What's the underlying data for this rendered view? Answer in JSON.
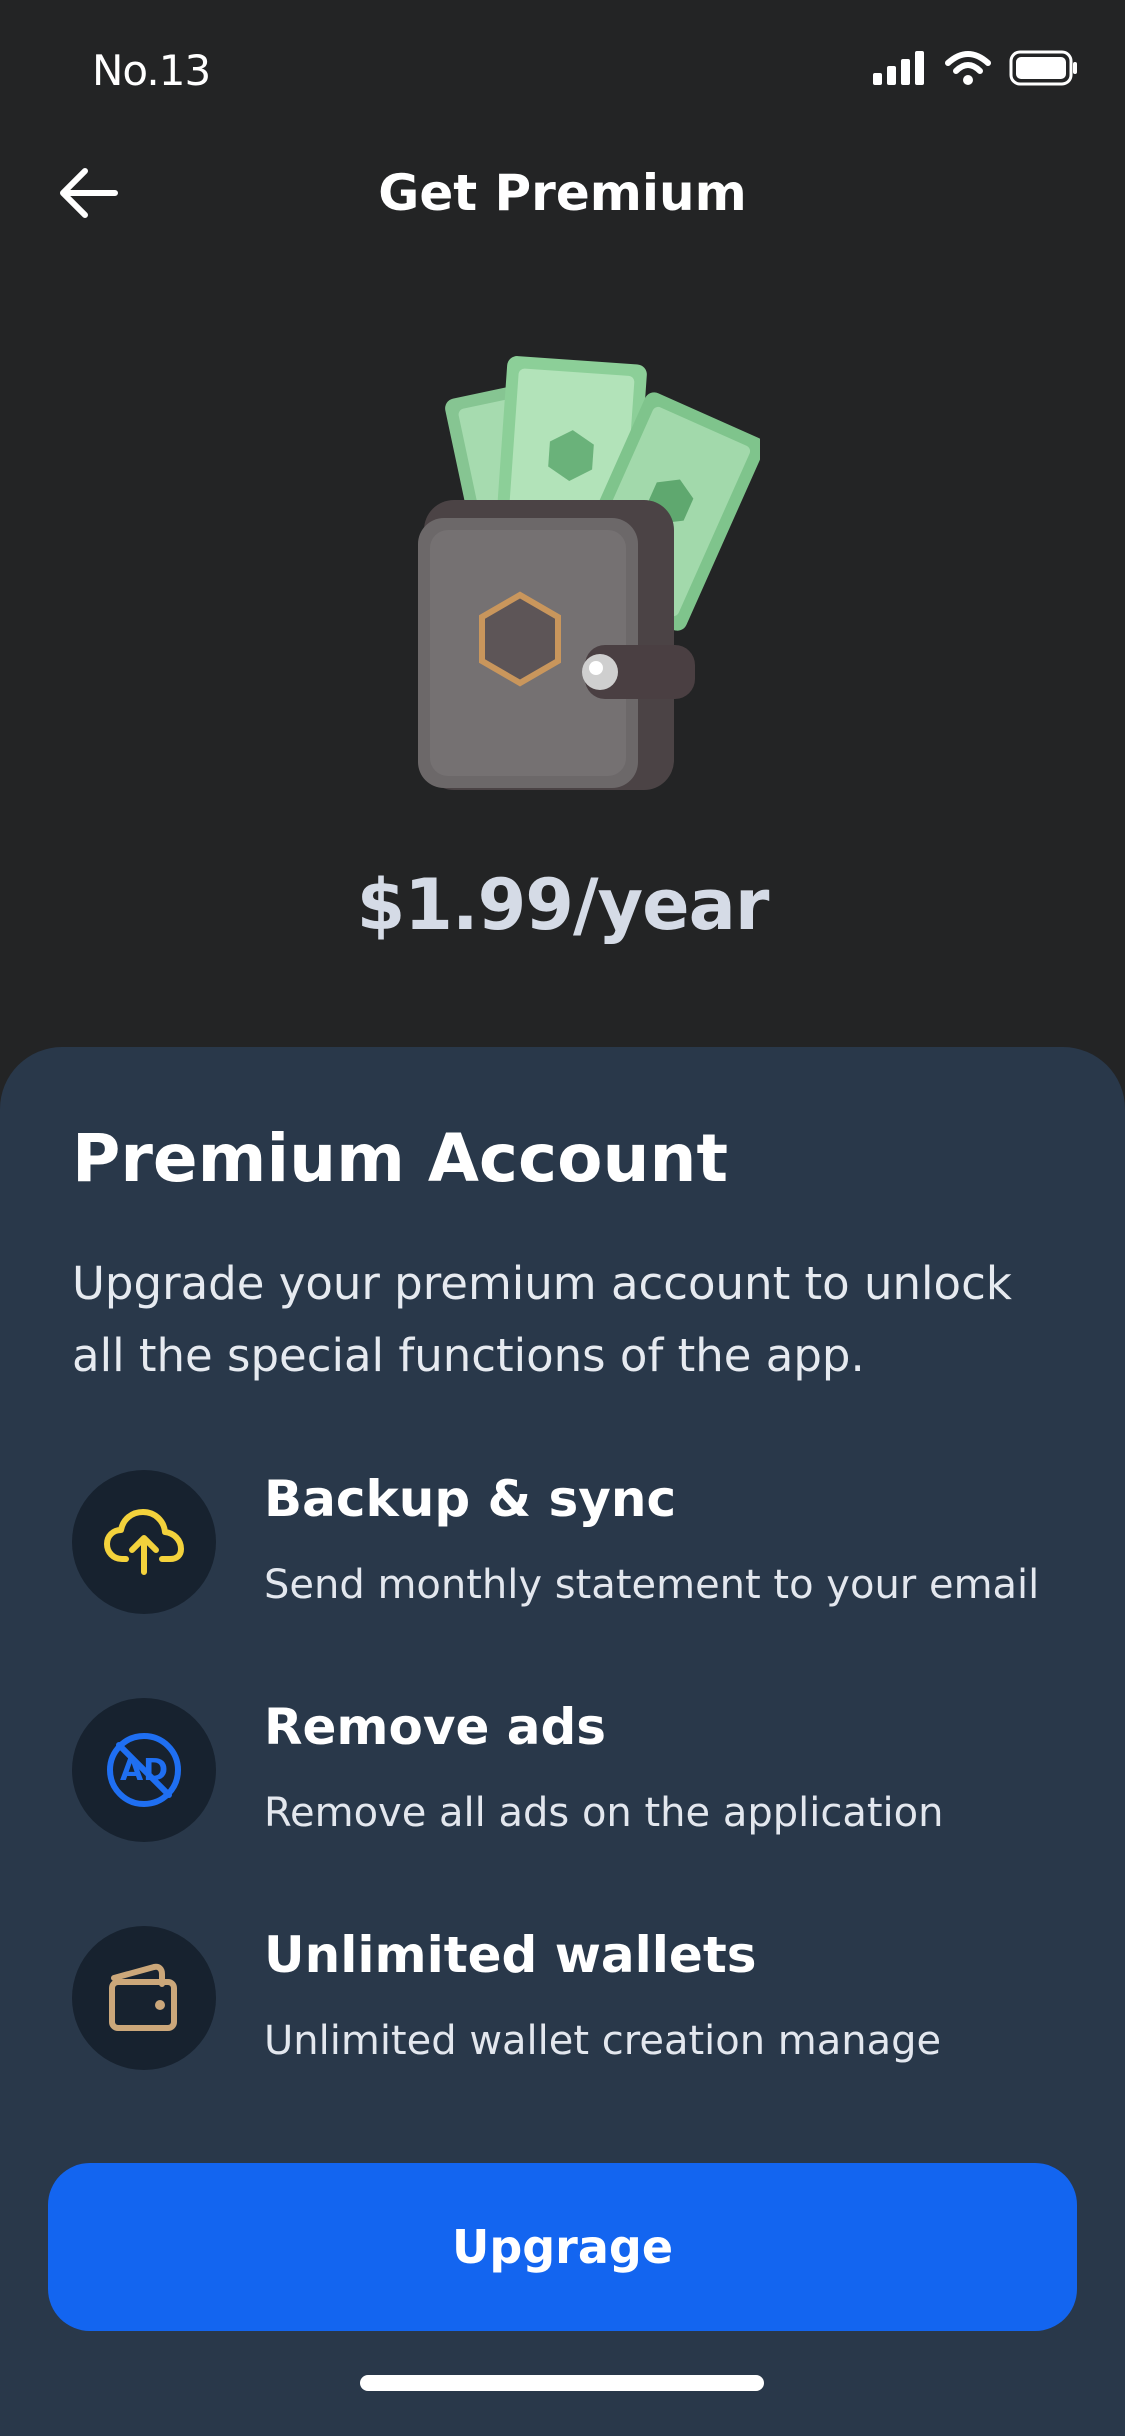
{
  "status_bar": {
    "time": "No.13",
    "icons": [
      "signal-icon",
      "wifi-icon",
      "battery-icon"
    ]
  },
  "header": {
    "back_icon": "arrow-left-icon",
    "title": "Get Premium"
  },
  "hero": {
    "illustration": "wallet-with-cash-illustration",
    "price": "$1.99/year"
  },
  "sheet": {
    "title": "Premium Account",
    "description": "Upgrade your premium account to unlock all the special functions of the app."
  },
  "features": [
    {
      "icon": "cloud-upload-icon",
      "icon_color": "#f3d23c",
      "title": "Backup & sync",
      "subtitle": "Send monthly statement to your email"
    },
    {
      "icon": "remove-ads-icon",
      "icon_color": "#1f6ff2",
      "title": "Remove ads",
      "subtitle": "Remove all ads on the application"
    },
    {
      "icon": "wallet-icon",
      "icon_color": "#cba77a",
      "title": "Unlimited wallets",
      "subtitle": "Unlimited wallet creation manage"
    }
  ],
  "cta": {
    "label": "Upgrage"
  },
  "colors": {
    "background": "#232425",
    "sheet": "#29384a",
    "accent": "#1365f0"
  }
}
